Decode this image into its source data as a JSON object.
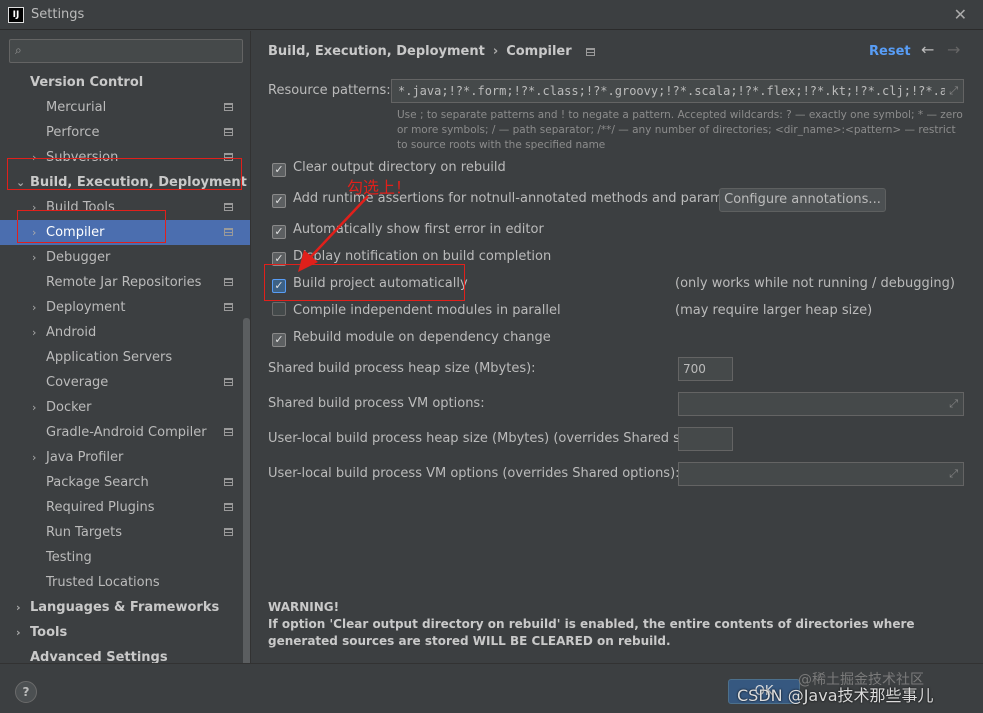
{
  "window": {
    "title": "Settings",
    "app_icon": "intellij-icon",
    "close": "✕"
  },
  "sidebar": {
    "search_placeholder": "",
    "items": [
      {
        "label": "Version Control",
        "level": 0,
        "bold": true,
        "arrow": "",
        "page_icon": false
      },
      {
        "label": "Mercurial",
        "level": 1,
        "arrow": "",
        "page_icon": true
      },
      {
        "label": "Perforce",
        "level": 1,
        "arrow": "",
        "page_icon": true
      },
      {
        "label": "Subversion",
        "level": 1,
        "arrow": "›",
        "page_icon": true
      },
      {
        "label": "Build, Execution, Deployment",
        "level": 0,
        "bold": true,
        "arrow": "⌄",
        "page_icon": false
      },
      {
        "label": "Build Tools",
        "level": 1,
        "arrow": "›",
        "page_icon": true
      },
      {
        "label": "Compiler",
        "level": 1,
        "arrow": "›",
        "page_icon": true,
        "selected": true
      },
      {
        "label": "Debugger",
        "level": 1,
        "arrow": "›",
        "page_icon": false
      },
      {
        "label": "Remote Jar Repositories",
        "level": 1,
        "arrow": "",
        "page_icon": true
      },
      {
        "label": "Deployment",
        "level": 1,
        "arrow": "›",
        "page_icon": true
      },
      {
        "label": "Android",
        "level": 1,
        "arrow": "›",
        "page_icon": false
      },
      {
        "label": "Application Servers",
        "level": 1,
        "arrow": "",
        "page_icon": false
      },
      {
        "label": "Coverage",
        "level": 1,
        "arrow": "",
        "page_icon": true
      },
      {
        "label": "Docker",
        "level": 1,
        "arrow": "›",
        "page_icon": false
      },
      {
        "label": "Gradle-Android Compiler",
        "level": 1,
        "arrow": "",
        "page_icon": true
      },
      {
        "label": "Java Profiler",
        "level": 1,
        "arrow": "›",
        "page_icon": false
      },
      {
        "label": "Package Search",
        "level": 1,
        "arrow": "",
        "page_icon": true
      },
      {
        "label": "Required Plugins",
        "level": 1,
        "arrow": "",
        "page_icon": true
      },
      {
        "label": "Run Targets",
        "level": 1,
        "arrow": "",
        "page_icon": true
      },
      {
        "label": "Testing",
        "level": 1,
        "arrow": "",
        "page_icon": false
      },
      {
        "label": "Trusted Locations",
        "level": 1,
        "arrow": "",
        "page_icon": false
      },
      {
        "label": "Languages & Frameworks",
        "level": 0,
        "bold": true,
        "arrow": "›",
        "page_icon": false
      },
      {
        "label": "Tools",
        "level": 0,
        "bold": true,
        "arrow": "›",
        "page_icon": false
      },
      {
        "label": "Advanced Settings",
        "level": 0,
        "bold": true,
        "arrow": "",
        "page_icon": false
      }
    ]
  },
  "header": {
    "crumb1": "Build, Execution, Deployment",
    "sep": "›",
    "crumb2": "Compiler",
    "reset": "Reset",
    "back": "←",
    "forward": "→"
  },
  "form": {
    "resource_label": "Resource patterns:",
    "resource_value": "*.java;!?*.form;!?*.class;!?*.groovy;!?*.scala;!?*.flex;!?*.kt;!?*.clj;!?*.aj",
    "hint": "Use ; to separate patterns and ! to negate a pattern. Accepted wildcards: ? — exactly one symbol; * — zero or more symbols; / — path separator; /**/ — any number of directories; <dir_name>:<pattern> — restrict to source roots with the specified name",
    "checkboxes": [
      {
        "label": "Clear output directory on rebuild",
        "checked": true
      },
      {
        "label": "Add runtime assertions for notnull-annotated methods and parameters",
        "checked": true
      },
      {
        "label": "Automatically show first error in editor",
        "checked": true
      },
      {
        "label": "Display notification on build completion",
        "checked": true
      },
      {
        "label": "Build project automatically",
        "checked": true
      },
      {
        "label": "Compile independent modules in parallel",
        "checked": false
      },
      {
        "label": "Rebuild module on dependency change",
        "checked": true
      }
    ],
    "configure_button": "Configure annotations...",
    "note_build_auto": "(only works while not running / debugging)",
    "note_parallel": "(may require larger heap size)",
    "heap_label": "Shared build process heap size (Mbytes):",
    "heap_value": "700",
    "vm_label": "Shared build process VM options:",
    "user_heap_label": "User-local build process heap size (Mbytes) (overrides Shared size):",
    "user_vm_label": "User-local build process VM options (overrides Shared options):"
  },
  "warning": {
    "title": "WARNING!",
    "body": "If option 'Clear output directory on rebuild' is enabled, the entire contents of directories where generated sources are stored WILL BE CLEARED on rebuild."
  },
  "footer": {
    "help": "?",
    "ok": "OK"
  },
  "annotation": {
    "text": "勾选上！"
  },
  "watermark": {
    "csdn": "CSDN @Java技术那些事儿",
    "juejin": "@稀土掘金技术社区"
  },
  "colors": {
    "accent": "#589df6",
    "selection": "#4b6eaf",
    "annotation": "#e0201b"
  }
}
